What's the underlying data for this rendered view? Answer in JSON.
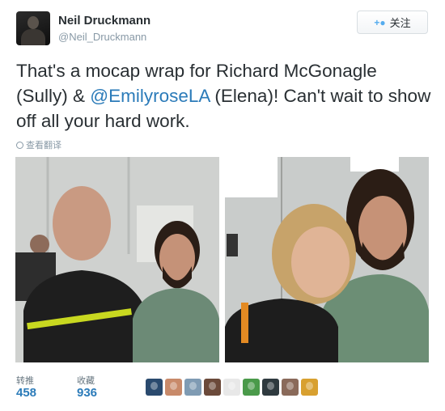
{
  "author": {
    "name": "Neil Druckmann",
    "handle": "@Neil_Druckmann"
  },
  "follow_button": {
    "label": "关注",
    "icon": "add-user-icon"
  },
  "tweet": {
    "text_before": "That's a mocap wrap for Richard McGonagle (Sully) & ",
    "mention": "@EmilyroseLA",
    "text_after": " (Elena)! Can't wait to show off all your hard work."
  },
  "translate": {
    "label": "查看翻译",
    "icon": "globe-icon"
  },
  "stats": {
    "retweets_label": "转推",
    "retweets_count": "458",
    "likes_label": "收藏",
    "likes_count": "936"
  },
  "liker_avatars": [
    {
      "color": "#2a4a6e"
    },
    {
      "color": "#c88a6a"
    },
    {
      "color": "#7f9bb3"
    },
    {
      "color": "#6b4a3a"
    },
    {
      "color": "#e8e8e8"
    },
    {
      "color": "#4a9a4a"
    },
    {
      "color": "#2f3a3f"
    },
    {
      "color": "#8a6a5a"
    },
    {
      "color": "#d8a030"
    }
  ]
}
